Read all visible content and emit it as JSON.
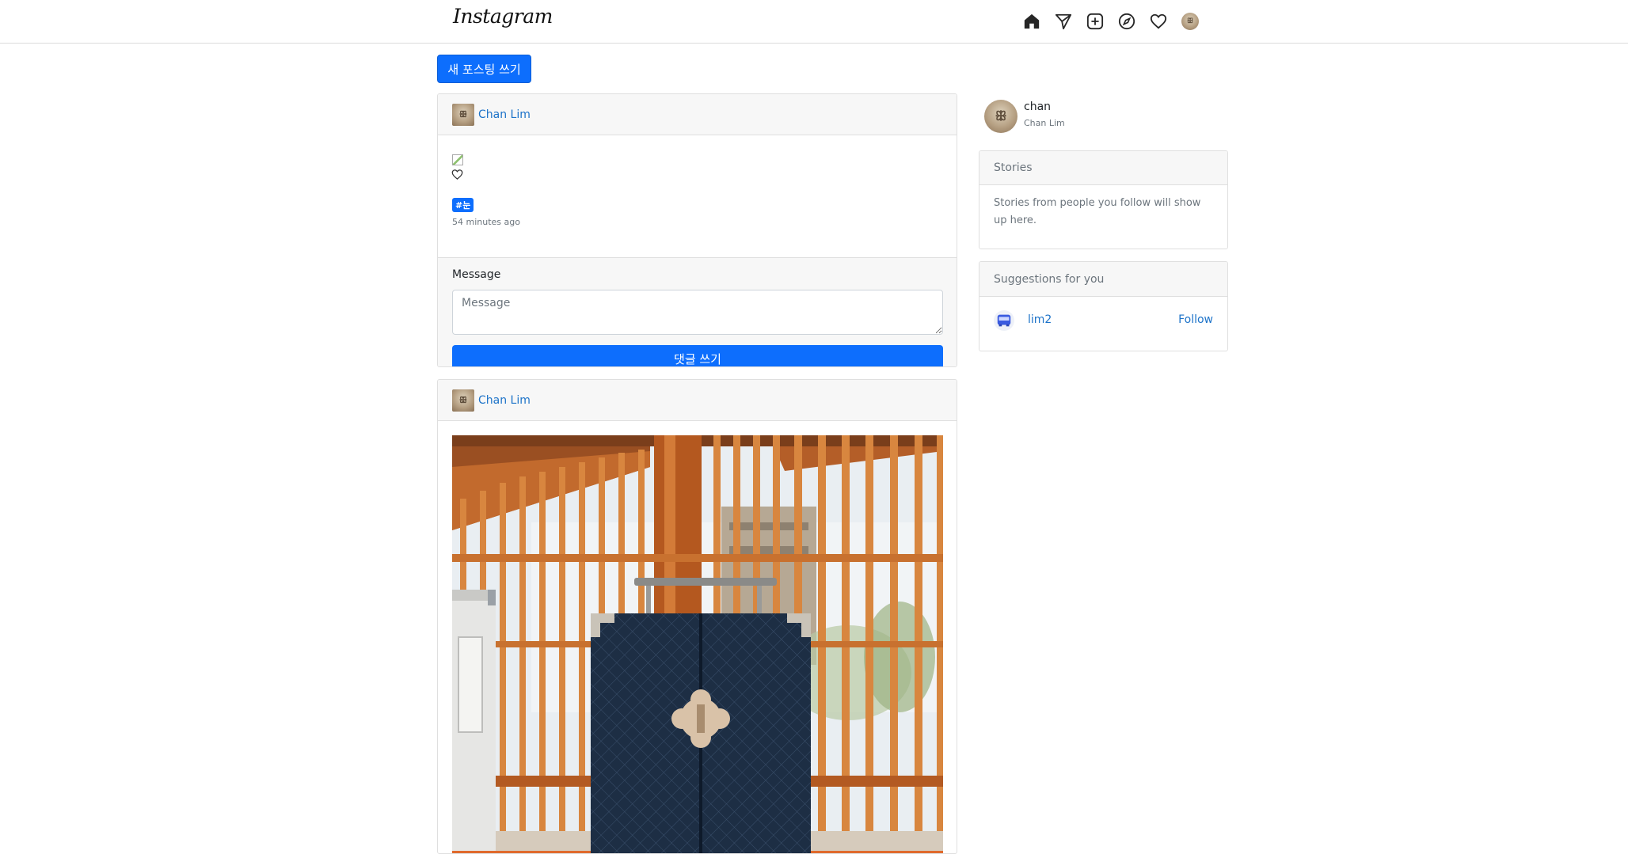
{
  "header": {
    "logo": "Instagram",
    "nav_icons": [
      "home-icon",
      "direct-icon",
      "new-post-icon",
      "explore-icon",
      "activity-icon",
      "profile-avatar"
    ]
  },
  "actions": {
    "new_post_label": "새 포스팅 쓰기"
  },
  "posts": [
    {
      "author": "Chan Lim",
      "hashtag": "#눈",
      "timestamp": "54 minutes ago",
      "comment_label": "Message",
      "comment_placeholder": "Message",
      "comment_value": "",
      "comment_button": "댓글 쓰기"
    },
    {
      "author": "Chan Lim"
    }
  ],
  "sidebar": {
    "username": "chan",
    "full_name": "Chan Lim",
    "stories": {
      "title": "Stories",
      "body": "Stories from people you follow will show up here."
    },
    "suggestions": {
      "title": "Suggestions for you",
      "items": [
        {
          "username": "lim2",
          "action": "Follow"
        }
      ]
    }
  },
  "colors": {
    "accent": "#0d6efd",
    "link": "#1d73c9",
    "card_header_bg": "#f7f7f7",
    "border": "#dfdfdf"
  }
}
